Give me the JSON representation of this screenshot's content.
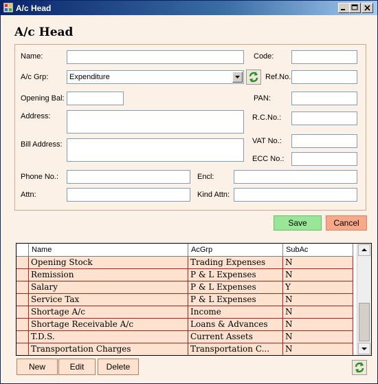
{
  "window": {
    "title": "A/c Head"
  },
  "heading": "A/c Head",
  "form": {
    "name_label": "Name:",
    "code_label": "Code:",
    "acgrp_label": "A/c Grp:",
    "acgrp_value": "Expenditure",
    "refno_label": "Ref.No.",
    "openingbal_label": "Opening Bal:",
    "pan_label": "PAN:",
    "address_label": "Address:",
    "rcno_label": "R.C.No.:",
    "billaddress_label": "Bill Address:",
    "vatno_label": "VAT No.:",
    "eccno_label": "ECC No.:",
    "phone_label": "Phone No.:",
    "encl_label": "Encl:",
    "attn_label": "Attn:",
    "kindattn_label": "Kind Attn:"
  },
  "actions": {
    "save": "Save",
    "cancel": "Cancel"
  },
  "grid": {
    "columns": [
      "Name",
      "AcGrp",
      "SubAc"
    ],
    "rows": [
      [
        "Opening Stock",
        "Trading Expenses",
        "N"
      ],
      [
        "Remission",
        "P & L Expenses",
        "N"
      ],
      [
        "Salary",
        "P & L Expenses",
        "Y"
      ],
      [
        "Service Tax",
        "P & L Expenses",
        "N"
      ],
      [
        "Shortage A/c",
        "Income",
        "N"
      ],
      [
        "Shortage Receivable A/c",
        "Loans & Advances",
        "N"
      ],
      [
        "T.D.S.",
        "Current Assets",
        "N"
      ],
      [
        "Transportation Charges",
        "Transportation C...",
        "N"
      ]
    ]
  },
  "bottom": {
    "new": "New",
    "edit": "Edit",
    "delete": "Delete"
  },
  "colors": {
    "save_bg": "#99e699",
    "cancel_bg": "#f7a98a",
    "row_bg": "#fde3cf",
    "grid_line": "#b22222"
  }
}
